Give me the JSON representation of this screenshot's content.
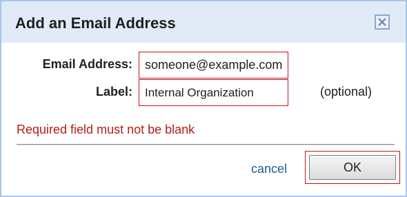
{
  "dialog": {
    "title": "Add an Email Address",
    "close_icon": "close-icon"
  },
  "form": {
    "email_label": "Email Address:",
    "email_value": "someone@example.com",
    "label_label": "Label:",
    "label_value": "Internal Organization",
    "optional_text": "(optional)"
  },
  "error": {
    "message": "Required field must not be blank",
    "color": "#b31b1b"
  },
  "actions": {
    "cancel_label": "cancel",
    "ok_label": "OK"
  },
  "colors": {
    "titlebar": "#e1ebf8",
    "border": "#a9c4ea",
    "highlight": "#c0141c",
    "link": "#1a5d99"
  }
}
